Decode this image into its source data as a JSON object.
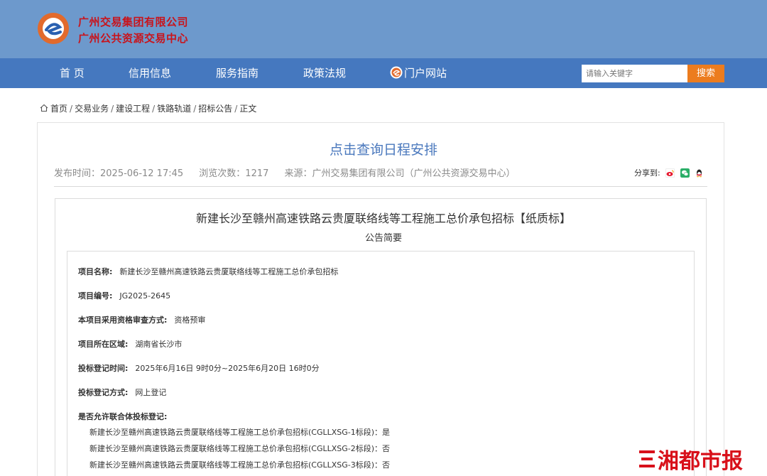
{
  "header": {
    "org_line1": "广州交易集团有限公司",
    "org_line2": "广州公共资源交易中心"
  },
  "nav": {
    "items": [
      "首 页",
      "信用信息",
      "服务指南",
      "政策法规"
    ],
    "portal": "门户网站",
    "search_placeholder": "请输入关键字",
    "search_button": "搜索"
  },
  "breadcrumb": [
    "首页",
    "交易业务",
    "建设工程",
    "铁路轨道",
    "招标公告",
    "正文"
  ],
  "article": {
    "link_title": "点击查询日程安排",
    "publish_time": "发布时间：2025-06-12 17:45",
    "views": "浏览次数：1217",
    "source": "来源：广州交易集团有限公司（广州公共资源交易中心）",
    "share_label": "分享到:"
  },
  "doc": {
    "title": "新建长沙至赣州高速铁路云贵厦联络线等工程施工总价承包招标【纸质标】",
    "subtitle": "公告简要",
    "fields": [
      {
        "label": "项目名称:",
        "value": "新建长沙至赣州高速铁路云贵厦联络线等工程施工总价承包招标"
      },
      {
        "label": "项目编号:",
        "value": "JG2025-2645"
      },
      {
        "label": "本项目采用资格审查方式:",
        "value": "资格预审"
      },
      {
        "label": "项目所在区域:",
        "value": "湖南省长沙市"
      },
      {
        "label": "投标登记时间:",
        "value": "2025年6月16日 9时0分~2025年6月20日 16时0分"
      },
      {
        "label": "投标登记方式:",
        "value": "网上登记"
      },
      {
        "label": "是否允许联合体投标登记:",
        "value": ""
      }
    ],
    "lots": [
      "新建长沙至赣州高速铁路云贵厦联络线等工程施工总价承包招标(CGLLXSG-1标段)：是",
      "新建长沙至赣州高速铁路云贵厦联络线等工程施工总价承包招标(CGLLXSG-2标段)：否",
      "新建长沙至赣州高速铁路云贵厦联络线等工程施工总价承包招标(CGLLXSG-3标段)：否"
    ]
  },
  "watermark": "三湘都市报",
  "colors": {
    "header_bg": "#6d99cc",
    "nav_bg": "#4578bf",
    "org_red": "#c8141c",
    "title_blue": "#4a78bd",
    "search_orange": "#ec7c1e"
  }
}
